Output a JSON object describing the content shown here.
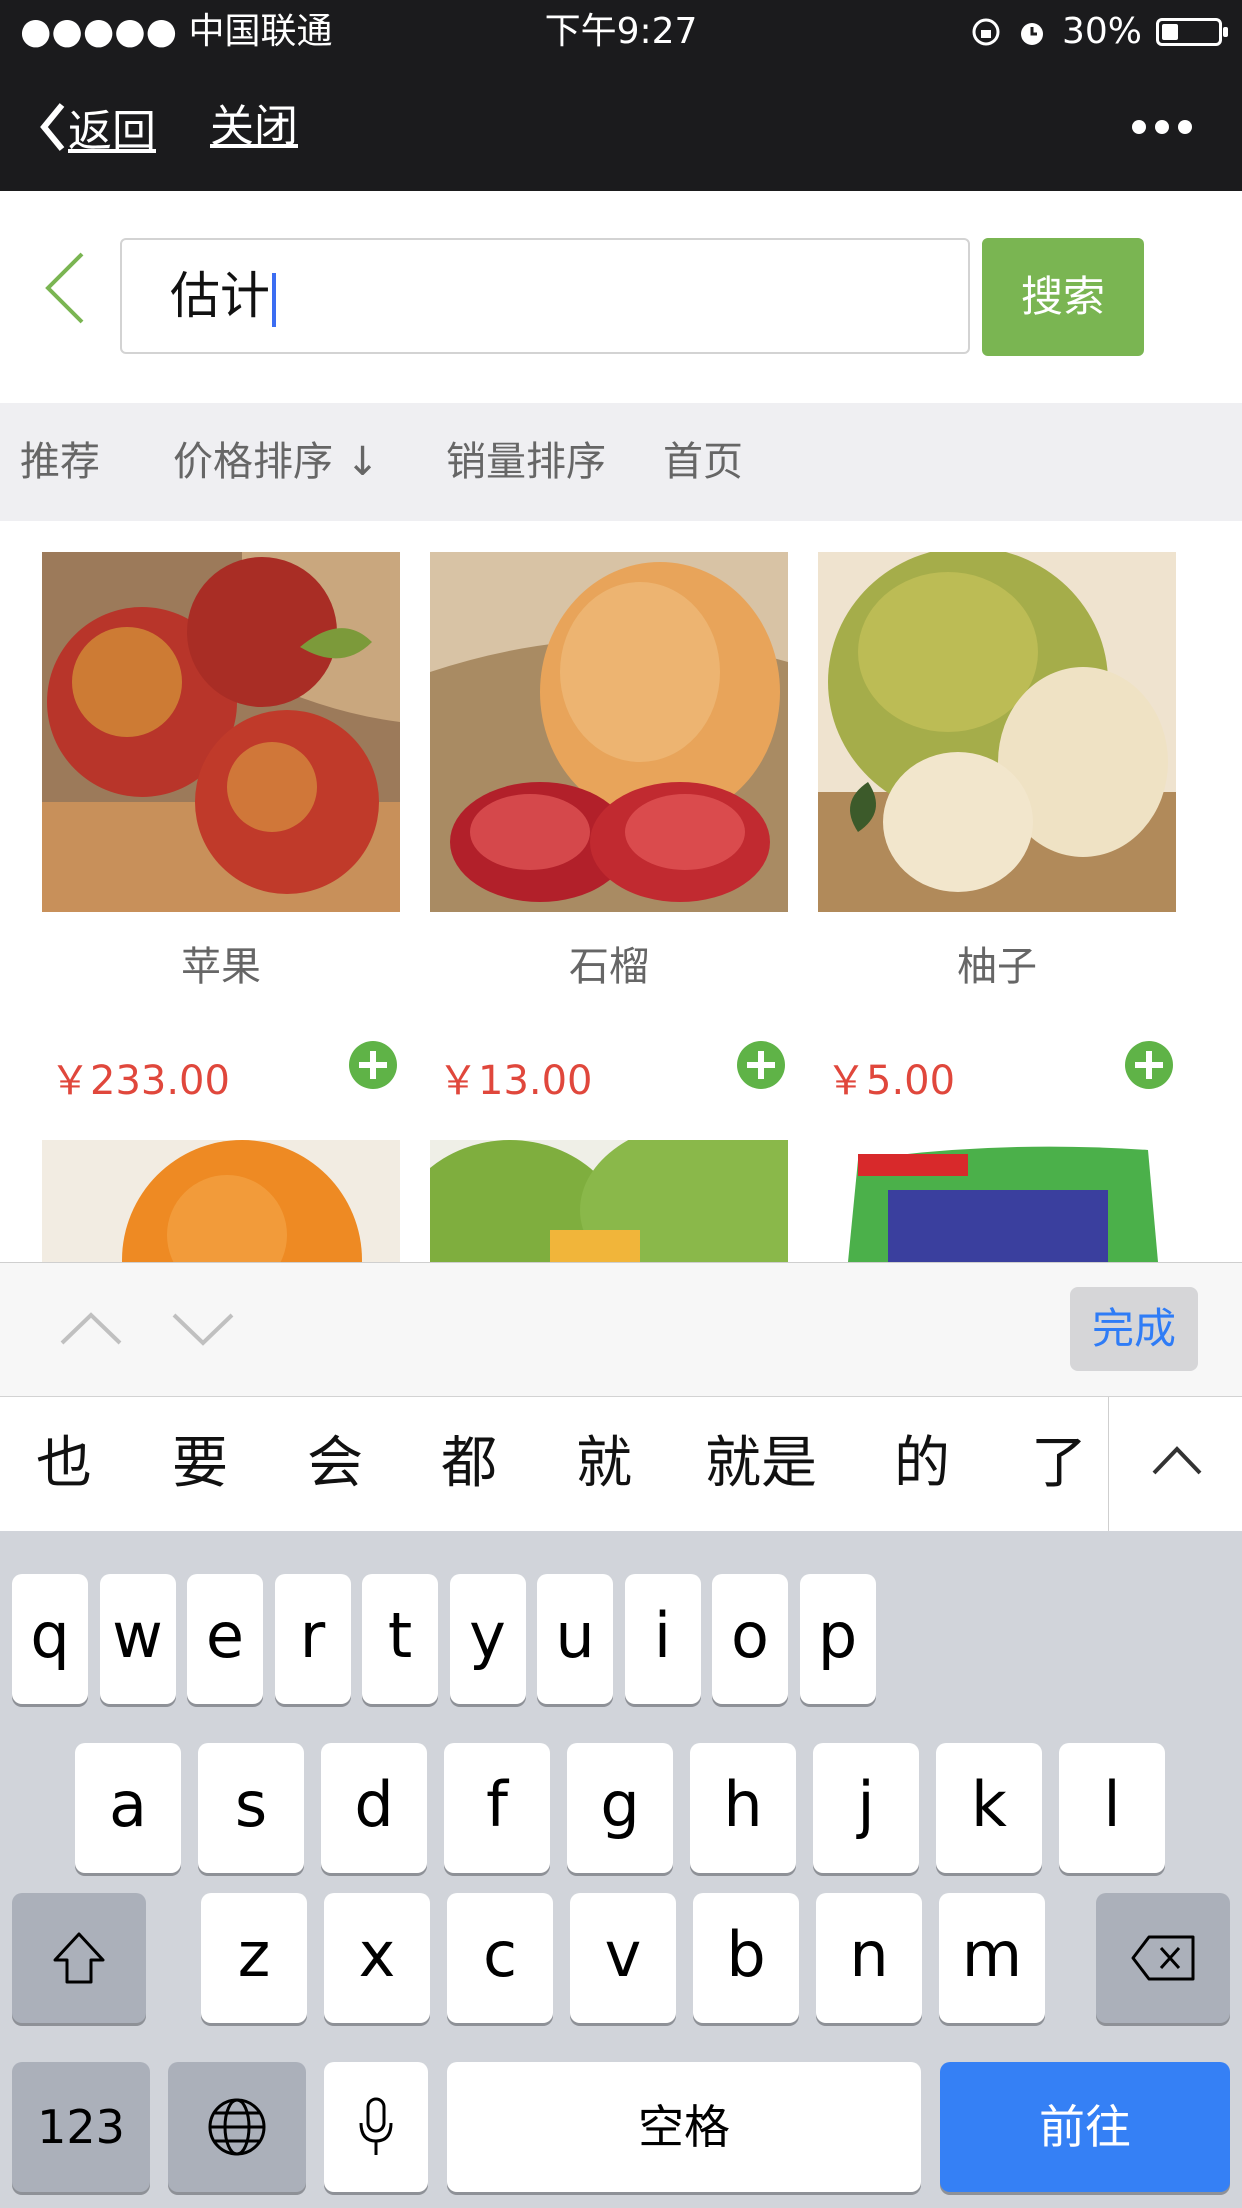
{
  "status_bar": {
    "carrier": "●●●●● 中国联通",
    "time": "下午9:27",
    "battery": "30%",
    "battery_level": 0.3
  },
  "nav": {
    "back_label": "返回",
    "close_label": "关闭"
  },
  "search": {
    "query": "估计",
    "button_label": "搜索"
  },
  "sort_tabs": [
    {
      "label": "推荐"
    },
    {
      "label": "价格排序 ↓"
    },
    {
      "label": "销量排序"
    },
    {
      "label": "首页"
    }
  ],
  "products": [
    {
      "name": "苹果",
      "price": "￥233.00"
    },
    {
      "name": "石榴",
      "price": "￥13.00"
    },
    {
      "name": "柚子",
      "price": "￥5.00"
    }
  ],
  "second_row_images": [
    "orange",
    "mango",
    "detergent-bag"
  ],
  "accessory": {
    "done_label": "完成"
  },
  "candidates": [
    "也",
    "要",
    "会",
    "都",
    "就",
    "就是",
    "的",
    "了"
  ],
  "keyboard": {
    "row1": [
      "q",
      "w",
      "e",
      "r",
      "t",
      "y",
      "u",
      "i",
      "o",
      "p"
    ],
    "row2": [
      "a",
      "s",
      "d",
      "f",
      "g",
      "h",
      "j",
      "k",
      "l"
    ],
    "row3": [
      "z",
      "x",
      "c",
      "v",
      "b",
      "n",
      "m"
    ],
    "numbers_label": "123",
    "space_label": "空格",
    "go_label": "前往"
  },
  "colors": {
    "accent_green": "#7ab552",
    "price_red": "#e0473c",
    "keyboard_blue": "#3580f5"
  }
}
